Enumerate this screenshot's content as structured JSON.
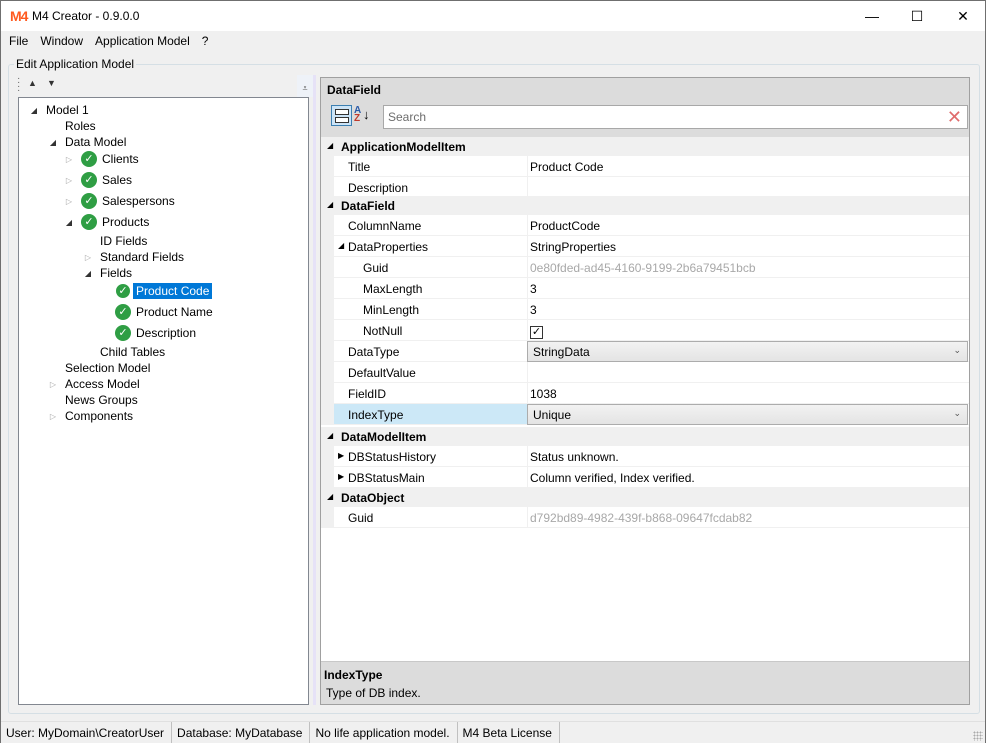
{
  "window": {
    "logo": "M4",
    "title": "M4 Creator - 0.9.0.0",
    "minimize_glyph": "—",
    "maximize_glyph": "☐",
    "close_glyph": "✕"
  },
  "menu": [
    "File",
    "Window",
    "Application Model",
    "?"
  ],
  "groupbox_label": "Edit Application Model",
  "tree_toolbar": {
    "up_glyph": "▲",
    "down_glyph": "▼",
    "overflow_glyph": "⩡"
  },
  "tree": [
    {
      "label": "Model 1",
      "level": 0,
      "arrow": "expanded",
      "icon": null
    },
    {
      "label": "Roles",
      "level": 1,
      "arrow": null,
      "icon": null
    },
    {
      "label": "Data Model",
      "level": 1,
      "arrow": "expanded",
      "icon": null
    },
    {
      "label": "Clients",
      "level": 2,
      "arrow": "collapsed",
      "icon": "check-circle"
    },
    {
      "label": "Sales",
      "level": 2,
      "arrow": "collapsed",
      "icon": "check-circle"
    },
    {
      "label": "Salespersons",
      "level": 2,
      "arrow": "collapsed",
      "icon": "check-circle"
    },
    {
      "label": "Products",
      "level": 2,
      "arrow": "expanded",
      "icon": "check-circle"
    },
    {
      "label": "ID Fields",
      "level": 3,
      "arrow": null,
      "icon": null
    },
    {
      "label": "Standard Fields",
      "level": 3,
      "arrow": "collapsed",
      "icon": null
    },
    {
      "label": "Fields",
      "level": 3,
      "arrow": "expanded",
      "icon": null
    },
    {
      "label": "Product Code",
      "level": 4,
      "arrow": null,
      "icon": "check-circle",
      "selected": true
    },
    {
      "label": "Product Name",
      "level": 4,
      "arrow": null,
      "icon": "check-circle"
    },
    {
      "label": "Description",
      "level": 4,
      "arrow": null,
      "icon": "check-circle"
    },
    {
      "label": "Child Tables",
      "level": 3,
      "arrow": null,
      "icon": null
    },
    {
      "label": "Selection Model",
      "level": 1,
      "arrow": null,
      "icon": null
    },
    {
      "label": "Access Model",
      "level": 1,
      "arrow": "collapsed",
      "icon": null
    },
    {
      "label": "News Groups",
      "level": 1,
      "arrow": null,
      "icon": null
    },
    {
      "label": "Components",
      "level": 1,
      "arrow": "collapsed",
      "icon": null
    }
  ],
  "property_grid": {
    "title": "DataField",
    "search_placeholder": "Search",
    "search_value": "",
    "rows": [
      {
        "type": "category",
        "label": "ApplicationModelItem"
      },
      {
        "type": "prop",
        "name": "Title",
        "value": "Product Code"
      },
      {
        "type": "prop",
        "name": "Description",
        "value": ""
      },
      {
        "type": "category",
        "label": "DataField"
      },
      {
        "type": "prop",
        "name": "ColumnName",
        "value": "ProductCode"
      },
      {
        "type": "prop",
        "name": "DataProperties",
        "value": "StringProperties",
        "expander": "expanded"
      },
      {
        "type": "prop",
        "name": "Guid",
        "value": "0e80fded-ad45-4160-9199-2b6a79451bcb",
        "sub": true,
        "readonly": true
      },
      {
        "type": "prop",
        "name": "MaxLength",
        "value": "3",
        "sub": true
      },
      {
        "type": "prop",
        "name": "MinLength",
        "value": "3",
        "sub": true
      },
      {
        "type": "prop",
        "name": "NotNull",
        "value": true,
        "sub": true,
        "editor": "checkbox"
      },
      {
        "type": "prop",
        "name": "DataType",
        "value": "StringData",
        "editor": "combo"
      },
      {
        "type": "prop",
        "name": "DefaultValue",
        "value": ""
      },
      {
        "type": "prop",
        "name": "FieldID",
        "value": "1038"
      },
      {
        "type": "prop",
        "name": "IndexType",
        "value": "Unique",
        "editor": "combo",
        "selected": true
      },
      {
        "type": "category",
        "label": "DataModelItem"
      },
      {
        "type": "prop",
        "name": "DBStatusHistory",
        "value": "Status unknown.",
        "expander": "collapsed"
      },
      {
        "type": "prop",
        "name": "DBStatusMain",
        "value": "Column verified, Index verified.",
        "expander": "collapsed"
      },
      {
        "type": "category",
        "label": "DataObject"
      },
      {
        "type": "prop",
        "name": "Guid",
        "value": "d792bd89-4982-439f-b868-09647fcdab82",
        "readonly": true
      }
    ],
    "help": {
      "title": "IndexType",
      "description": "Type of DB index."
    }
  },
  "statusbar": [
    "User: MyDomain\\CreatorUser",
    "Database: MyDatabase",
    "No life application model.",
    "M4 Beta License"
  ],
  "colors": {
    "accent": "#0078d7",
    "logo": "#ff5a1f",
    "check": "#2f9e44",
    "selected_prop": "#cce8f7"
  }
}
